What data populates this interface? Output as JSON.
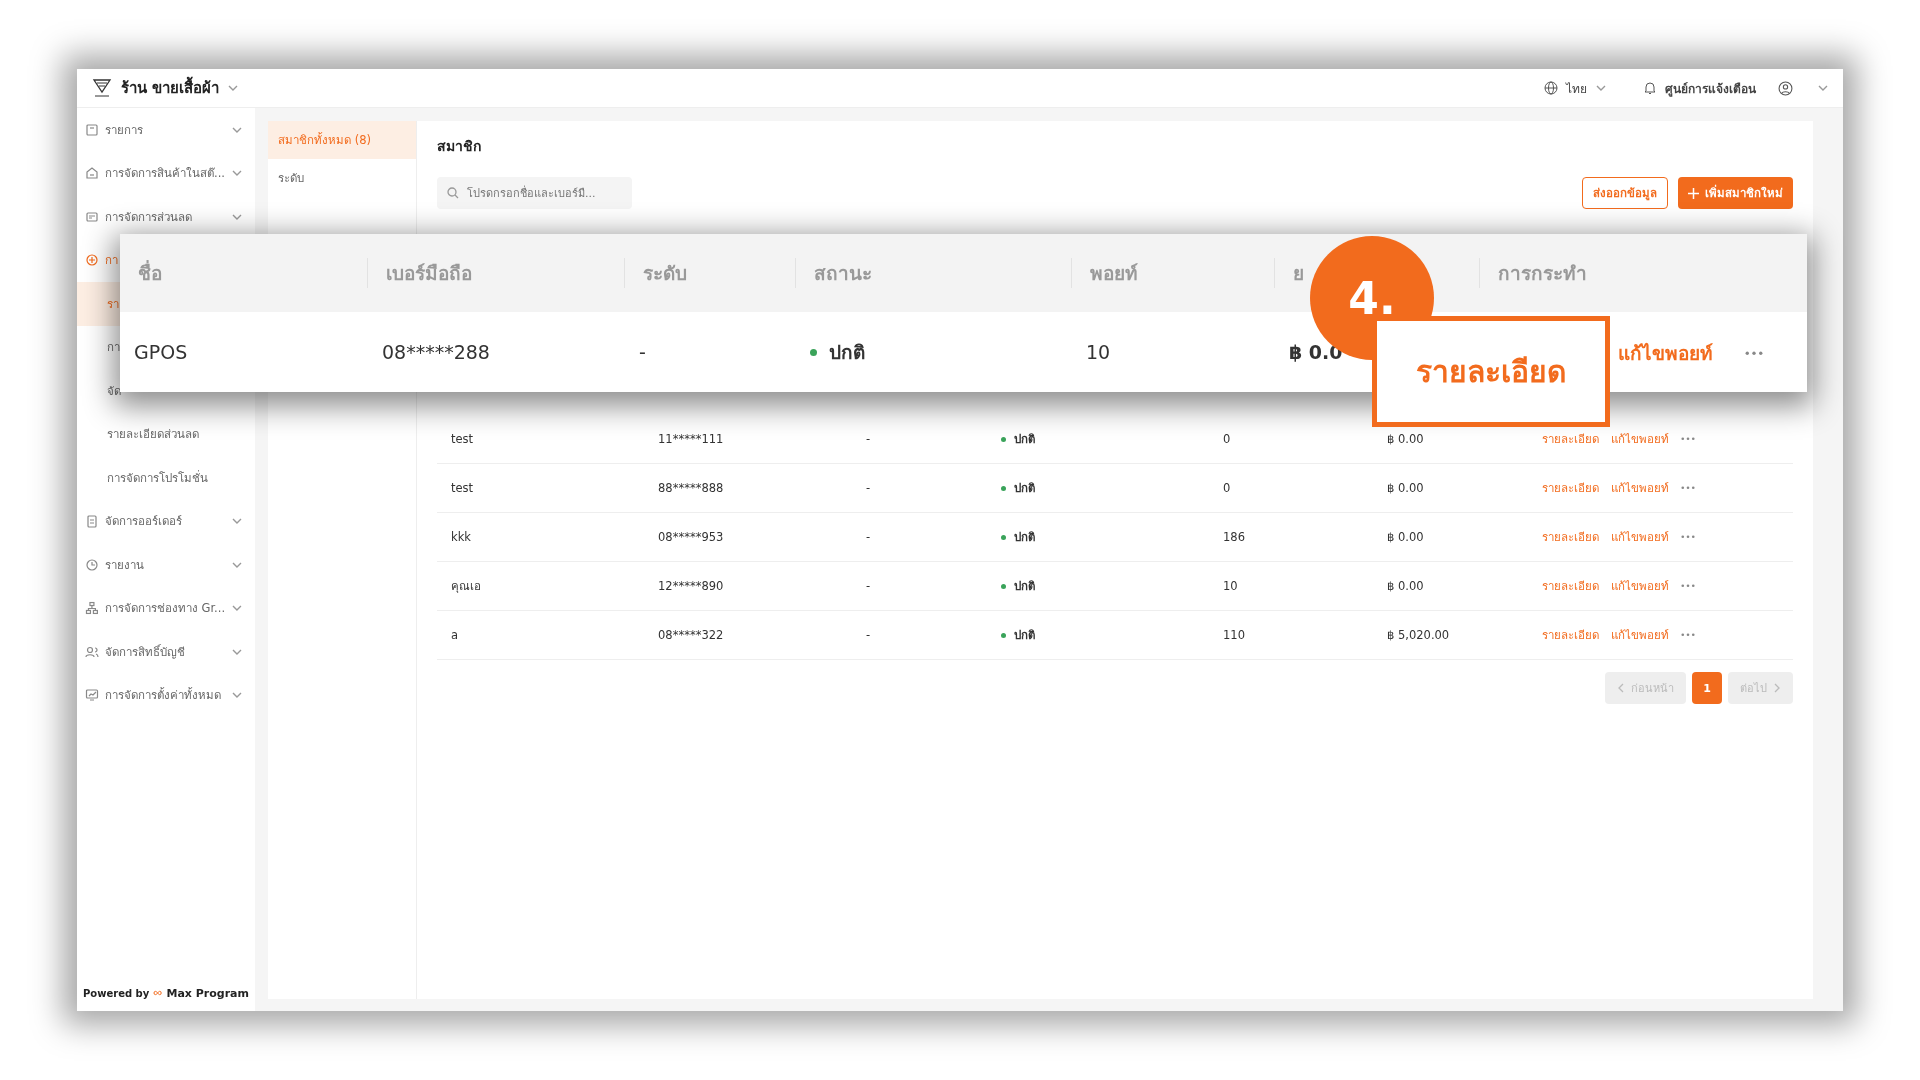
{
  "header": {
    "store_name": "ร้าน ขายเสื้อผ้า",
    "language": "ไทย",
    "notifications": "ศูนย์การแจ้งเตือน"
  },
  "sidebar": {
    "items": [
      {
        "label": "รายการ",
        "selected": false
      },
      {
        "label": "การจัดการสินค้าในสต๊...",
        "selected": false
      },
      {
        "label": "การจัดการส่วนลด",
        "selected": false
      },
      {
        "label": "กา",
        "selected": true,
        "children": [
          {
            "label": "รา",
            "selected": true
          },
          {
            "label": "กา",
            "selected": false
          },
          {
            "label": "จัด",
            "selected": false
          },
          {
            "label": "รายละเอียดส่วนลด",
            "selected": false
          },
          {
            "label": "การจัดการโปรโมชั่น",
            "selected": false
          }
        ]
      },
      {
        "label": "จัดการออร์เดอร์",
        "selected": false
      },
      {
        "label": "รายงาน",
        "selected": false
      },
      {
        "label": "การจัดการช่องทาง Gr...",
        "selected": false
      },
      {
        "label": "จัดการสิทธิ์บัญชี",
        "selected": false
      },
      {
        "label": "การจัดการตั้งค่าทั้งหมด",
        "selected": false
      }
    ],
    "powered_by": "Powered by",
    "brand": "Max Program"
  },
  "tabs": [
    {
      "label": "สมาชิกทั้งหมด",
      "count": "(8)",
      "selected": true
    },
    {
      "label": "ระดับ",
      "selected": false
    }
  ],
  "main": {
    "title": "สมาชิก",
    "search": {
      "placeholder": "โปรดกรอกชื่อและเบอร์มื..."
    },
    "export_button": "ส่งออกข้อมูล",
    "add_button": "เพิ่มสมาชิกใหม่",
    "rows": [
      {
        "name": "test",
        "phone": "11*****111",
        "level": "-",
        "status": "ปกติ",
        "points": "0",
        "amount": "฿ 0.00",
        "details": "รายละเอียด",
        "edit": "แก้ไขพอยท์"
      },
      {
        "name": "test",
        "phone": "88*****888",
        "level": "-",
        "status": "ปกติ",
        "points": "0",
        "amount": "฿ 0.00",
        "details": "รายละเอียด",
        "edit": "แก้ไขพอยท์"
      },
      {
        "name": "kkk",
        "phone": "08*****953",
        "level": "-",
        "status": "ปกติ",
        "points": "186",
        "amount": "฿ 0.00",
        "details": "รายละเอียด",
        "edit": "แก้ไขพอยท์"
      },
      {
        "name": "คุณเอ",
        "phone": "12*****890",
        "level": "-",
        "status": "ปกติ",
        "points": "10",
        "amount": "฿ 0.00",
        "details": "รายละเอียด",
        "edit": "แก้ไขพอยท์"
      },
      {
        "name": "a",
        "phone": "08*****322",
        "level": "-",
        "status": "ปกติ",
        "points": "110",
        "amount": "฿ 5,020.00",
        "details": "รายละเอียด",
        "edit": "แก้ไขพอยท์"
      }
    ],
    "pagination": {
      "prev": "ก่อนหน้า",
      "next": "ต่อไป",
      "prev_disabled": true,
      "next_disabled": true,
      "pages": [
        {
          "label": "1",
          "selected": true
        }
      ]
    }
  },
  "callout": {
    "columns": [
      "ชื่อ",
      "เบอร์มือถือ",
      "ระดับ",
      "สถานะ",
      "พอยท์",
      "ย",
      "การกระทำ"
    ],
    "row": {
      "name": "GPOS",
      "phone": "08*****288",
      "level": "-",
      "status": "ปกติ",
      "points": "10",
      "amount": "฿ 0.0",
      "edit": "แก้ไขพอยท์"
    },
    "badge": "4.",
    "highlight": "รายละเอียด"
  }
}
